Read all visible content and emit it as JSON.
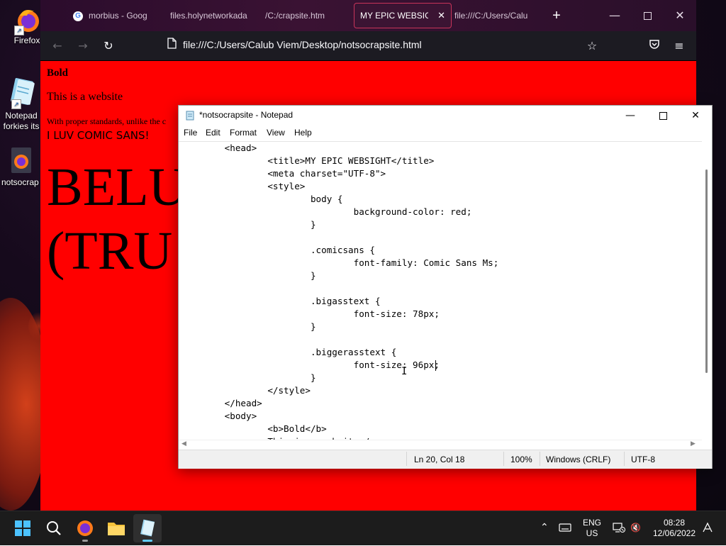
{
  "desktop": {
    "icons": [
      {
        "label": "Firefox"
      },
      {
        "label_line1": "Notepad",
        "label_line2": "forkies its"
      },
      {
        "label": "notsocrap"
      }
    ]
  },
  "firefox": {
    "tabs": [
      {
        "label": "morbius - Goog",
        "favicon": "google-icon"
      },
      {
        "label": "files.holynetworkada"
      },
      {
        "label": "/C:/crapsite.htm"
      },
      {
        "label": "MY EPIC WEBSIGH",
        "active": true
      },
      {
        "label": "file:///C:/Users/Calu"
      }
    ],
    "new_tab_symbol": "+",
    "url": "file:///C:/Users/Calub Viem/Desktop/notsocrapsite.html",
    "page": {
      "bold_text": "Bold",
      "line1": "This is a website",
      "line2": "With proper standards, unlike the c",
      "comic_text": "I LUV COMIC SANS!",
      "big1": "BELU",
      "big2": "(TRU"
    }
  },
  "notepad": {
    "title": "*notsocrapsite - Notepad",
    "menu": [
      "File",
      "Edit",
      "Format",
      "View",
      "Help"
    ],
    "code_lines": [
      "        <head>",
      "                <title>MY EPIC WEBSIGHT</title>",
      "                <meta charset=\"UTF-8\">",
      "                <style>",
      "                        body {",
      "                                background-color: red;",
      "                        }",
      "",
      "                        .comicsans {",
      "                                font-family: Comic Sans Ms;",
      "                        }",
      "",
      "                        .bigasstext {",
      "                                font-size: 78px;",
      "                        }",
      "",
      "                        .biggerasstext {",
      "                                font-size: 96px;",
      "                        }",
      "                </style>",
      "        </head>",
      "        <body>",
      "                <b>Bold</b>",
      "                This is a website</p>"
    ],
    "status": {
      "position": "Ln 20, Col 18",
      "zoom": "100%",
      "line_endings": "Windows (CRLF)",
      "encoding": "UTF-8"
    }
  },
  "taskbar": {
    "lang_line1": "ENG",
    "lang_line2": "US",
    "time": "08:28",
    "date": "12/06/2022"
  }
}
